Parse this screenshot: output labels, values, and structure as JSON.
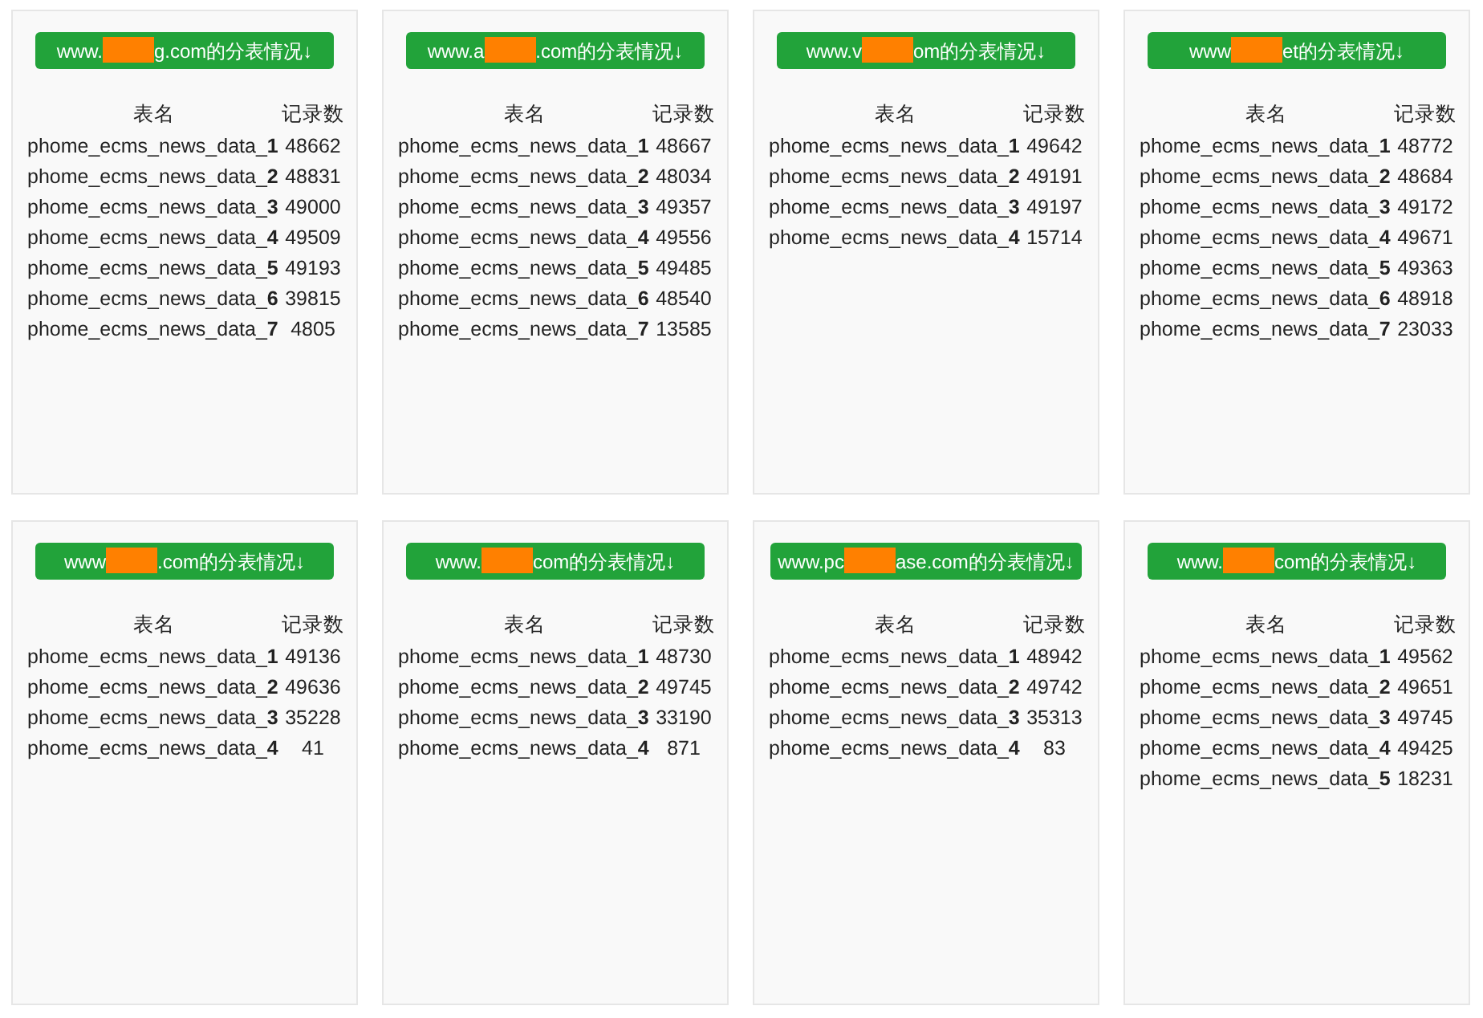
{
  "cards": [
    {
      "title_before": "www.",
      "title_after": "g.com的分表情况↓",
      "columns": [
        "表名",
        "记录数"
      ],
      "rows": [
        [
          "phome_ecms_news_data_**1**",
          "48662"
        ],
        [
          "phome_ecms_news_data_**2**",
          "48831"
        ],
        [
          "phome_ecms_news_data_**3**",
          "49000"
        ],
        [
          "phome_ecms_news_data_**4**",
          "49509"
        ],
        [
          "phome_ecms_news_data_**5**",
          "49193"
        ],
        [
          "phome_ecms_news_data_**6**",
          "39815"
        ],
        [
          "phome_ecms_news_data_**7**",
          "4805"
        ]
      ]
    },
    {
      "title_before": "www.a",
      "title_after": ".com的分表情况↓",
      "columns": [
        "表名",
        "记录数"
      ],
      "rows": [
        [
          "phome_ecms_news_data_**1**",
          "48667"
        ],
        [
          "phome_ecms_news_data_**2**",
          "48034"
        ],
        [
          "phome_ecms_news_data_**3**",
          "49357"
        ],
        [
          "phome_ecms_news_data_**4**",
          "49556"
        ],
        [
          "phome_ecms_news_data_**5**",
          "49485"
        ],
        [
          "phome_ecms_news_data_**6**",
          "48540"
        ],
        [
          "phome_ecms_news_data_**7**",
          "13585"
        ]
      ]
    },
    {
      "title_before": "www.v",
      "title_after": "om的分表情况↓",
      "columns": [
        "表名",
        "记录数"
      ],
      "rows": [
        [
          "phome_ecms_news_data_**1**",
          "49642"
        ],
        [
          "phome_ecms_news_data_**2**",
          "49191"
        ],
        [
          "phome_ecms_news_data_**3**",
          "49197"
        ],
        [
          "phome_ecms_news_data_**4**",
          "15714"
        ]
      ]
    },
    {
      "title_before": "www",
      "title_after": "et的分表情况↓",
      "columns": [
        "表名",
        "记录数"
      ],
      "rows": [
        [
          "phome_ecms_news_data_**1**",
          "48772"
        ],
        [
          "phome_ecms_news_data_**2**",
          "48684"
        ],
        [
          "phome_ecms_news_data_**3**",
          "49172"
        ],
        [
          "phome_ecms_news_data_**4**",
          "49671"
        ],
        [
          "phome_ecms_news_data_**5**",
          "49363"
        ],
        [
          "phome_ecms_news_data_**6**",
          "48918"
        ],
        [
          "phome_ecms_news_data_**7**",
          "23033"
        ]
      ]
    },
    {
      "title_before": "www",
      "title_after": ".com的分表情况↓",
      "columns": [
        "表名",
        "记录数"
      ],
      "rows": [
        [
          "phome_ecms_news_data_**1**",
          "49136"
        ],
        [
          "phome_ecms_news_data_**2**",
          "49636"
        ],
        [
          "phome_ecms_news_data_**3**",
          "35228"
        ],
        [
          "phome_ecms_news_data_**4**",
          "41"
        ]
      ]
    },
    {
      "title_before": "www.",
      "title_after": "com的分表情况↓",
      "columns": [
        "表名",
        "记录数"
      ],
      "rows": [
        [
          "phome_ecms_news_data_**1**",
          "48730"
        ],
        [
          "phome_ecms_news_data_**2**",
          "49745"
        ],
        [
          "phome_ecms_news_data_**3**",
          "33190"
        ],
        [
          "phome_ecms_news_data_**4**",
          "871"
        ]
      ]
    },
    {
      "title_before": "www.pc",
      "title_after": "ase.com的分表情况↓",
      "columns": [
        "表名",
        "记录数"
      ],
      "rows": [
        [
          "phome_ecms_news_data_**1**",
          "48942"
        ],
        [
          "phome_ecms_news_data_**2**",
          "49742"
        ],
        [
          "phome_ecms_news_data_**3**",
          "35313"
        ],
        [
          "phome_ecms_news_data_**4**",
          "83"
        ]
      ]
    },
    {
      "title_before": "www.",
      "title_after": "com的分表情况↓",
      "columns": [
        "表名",
        "记录数"
      ],
      "rows": [
        [
          "phome_ecms_news_data_**1**",
          "49562"
        ],
        [
          "phome_ecms_news_data_**2**",
          "49651"
        ],
        [
          "phome_ecms_news_data_**3**",
          "49745"
        ],
        [
          "phome_ecms_news_data_**4**",
          "49425"
        ],
        [
          "phome_ecms_news_data_**5**",
          "18231"
        ]
      ]
    }
  ]
}
